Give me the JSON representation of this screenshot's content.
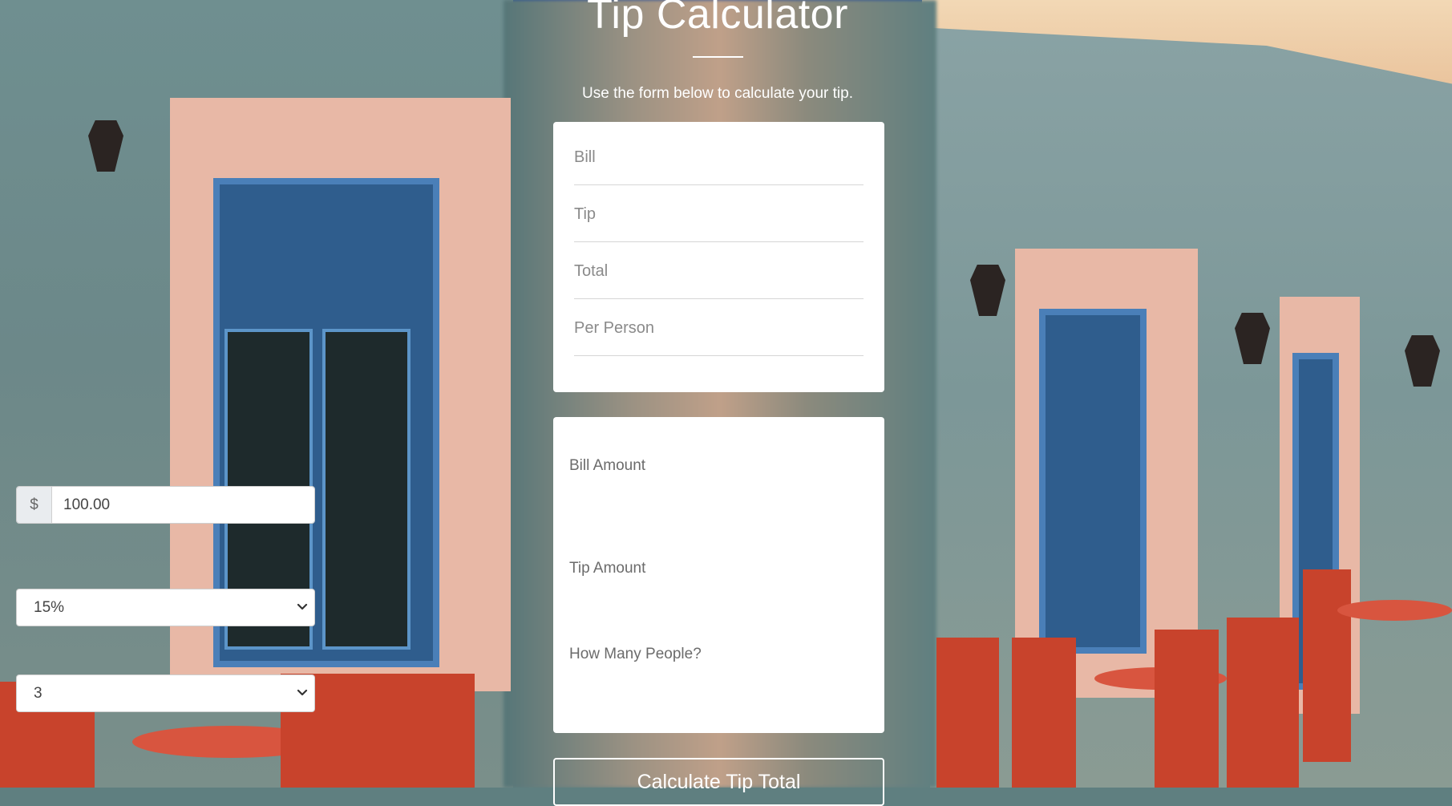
{
  "page": {
    "title": "Tip Calculator",
    "subtitle": "Use the form below to calculate your tip."
  },
  "results": {
    "bill_label": "Bill",
    "tip_label": "Tip",
    "total_label": "Total",
    "per_person_label": "Per Person"
  },
  "form": {
    "bill_amount_label": "Bill Amount",
    "currency_symbol": "$",
    "bill_amount_value": "100.00",
    "tip_amount_label": "Tip Amount",
    "tip_amount_selected": "15%",
    "people_label": "How Many People?",
    "people_selected": "3",
    "submit_label": "Calculate Tip Total"
  },
  "colors": {
    "top_accent": "#2a4f98",
    "card_background": "#ffffff",
    "title_text": "#ffffff"
  },
  "icons": {
    "select_arrow": "chevron-down-icon"
  }
}
